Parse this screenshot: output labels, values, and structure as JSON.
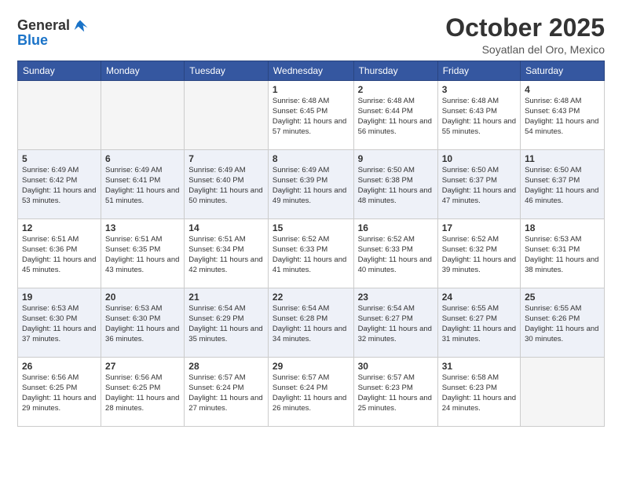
{
  "header": {
    "logo_general": "General",
    "logo_blue": "Blue",
    "month_title": "October 2025",
    "location": "Soyatlan del Oro, Mexico"
  },
  "days_of_week": [
    "Sunday",
    "Monday",
    "Tuesday",
    "Wednesday",
    "Thursday",
    "Friday",
    "Saturday"
  ],
  "weeks": [
    [
      {
        "day": "",
        "info": ""
      },
      {
        "day": "",
        "info": ""
      },
      {
        "day": "",
        "info": ""
      },
      {
        "day": "1",
        "info": "Sunrise: 6:48 AM\nSunset: 6:45 PM\nDaylight: 11 hours\nand 57 minutes."
      },
      {
        "day": "2",
        "info": "Sunrise: 6:48 AM\nSunset: 6:44 PM\nDaylight: 11 hours\nand 56 minutes."
      },
      {
        "day": "3",
        "info": "Sunrise: 6:48 AM\nSunset: 6:43 PM\nDaylight: 11 hours\nand 55 minutes."
      },
      {
        "day": "4",
        "info": "Sunrise: 6:48 AM\nSunset: 6:43 PM\nDaylight: 11 hours\nand 54 minutes."
      }
    ],
    [
      {
        "day": "5",
        "info": "Sunrise: 6:49 AM\nSunset: 6:42 PM\nDaylight: 11 hours\nand 53 minutes."
      },
      {
        "day": "6",
        "info": "Sunrise: 6:49 AM\nSunset: 6:41 PM\nDaylight: 11 hours\nand 51 minutes."
      },
      {
        "day": "7",
        "info": "Sunrise: 6:49 AM\nSunset: 6:40 PM\nDaylight: 11 hours\nand 50 minutes."
      },
      {
        "day": "8",
        "info": "Sunrise: 6:49 AM\nSunset: 6:39 PM\nDaylight: 11 hours\nand 49 minutes."
      },
      {
        "day": "9",
        "info": "Sunrise: 6:50 AM\nSunset: 6:38 PM\nDaylight: 11 hours\nand 48 minutes."
      },
      {
        "day": "10",
        "info": "Sunrise: 6:50 AM\nSunset: 6:37 PM\nDaylight: 11 hours\nand 47 minutes."
      },
      {
        "day": "11",
        "info": "Sunrise: 6:50 AM\nSunset: 6:37 PM\nDaylight: 11 hours\nand 46 minutes."
      }
    ],
    [
      {
        "day": "12",
        "info": "Sunrise: 6:51 AM\nSunset: 6:36 PM\nDaylight: 11 hours\nand 45 minutes."
      },
      {
        "day": "13",
        "info": "Sunrise: 6:51 AM\nSunset: 6:35 PM\nDaylight: 11 hours\nand 43 minutes."
      },
      {
        "day": "14",
        "info": "Sunrise: 6:51 AM\nSunset: 6:34 PM\nDaylight: 11 hours\nand 42 minutes."
      },
      {
        "day": "15",
        "info": "Sunrise: 6:52 AM\nSunset: 6:33 PM\nDaylight: 11 hours\nand 41 minutes."
      },
      {
        "day": "16",
        "info": "Sunrise: 6:52 AM\nSunset: 6:33 PM\nDaylight: 11 hours\nand 40 minutes."
      },
      {
        "day": "17",
        "info": "Sunrise: 6:52 AM\nSunset: 6:32 PM\nDaylight: 11 hours\nand 39 minutes."
      },
      {
        "day": "18",
        "info": "Sunrise: 6:53 AM\nSunset: 6:31 PM\nDaylight: 11 hours\nand 38 minutes."
      }
    ],
    [
      {
        "day": "19",
        "info": "Sunrise: 6:53 AM\nSunset: 6:30 PM\nDaylight: 11 hours\nand 37 minutes."
      },
      {
        "day": "20",
        "info": "Sunrise: 6:53 AM\nSunset: 6:30 PM\nDaylight: 11 hours\nand 36 minutes."
      },
      {
        "day": "21",
        "info": "Sunrise: 6:54 AM\nSunset: 6:29 PM\nDaylight: 11 hours\nand 35 minutes."
      },
      {
        "day": "22",
        "info": "Sunrise: 6:54 AM\nSunset: 6:28 PM\nDaylight: 11 hours\nand 34 minutes."
      },
      {
        "day": "23",
        "info": "Sunrise: 6:54 AM\nSunset: 6:27 PM\nDaylight: 11 hours\nand 32 minutes."
      },
      {
        "day": "24",
        "info": "Sunrise: 6:55 AM\nSunset: 6:27 PM\nDaylight: 11 hours\nand 31 minutes."
      },
      {
        "day": "25",
        "info": "Sunrise: 6:55 AM\nSunset: 6:26 PM\nDaylight: 11 hours\nand 30 minutes."
      }
    ],
    [
      {
        "day": "26",
        "info": "Sunrise: 6:56 AM\nSunset: 6:25 PM\nDaylight: 11 hours\nand 29 minutes."
      },
      {
        "day": "27",
        "info": "Sunrise: 6:56 AM\nSunset: 6:25 PM\nDaylight: 11 hours\nand 28 minutes."
      },
      {
        "day": "28",
        "info": "Sunrise: 6:57 AM\nSunset: 6:24 PM\nDaylight: 11 hours\nand 27 minutes."
      },
      {
        "day": "29",
        "info": "Sunrise: 6:57 AM\nSunset: 6:24 PM\nDaylight: 11 hours\nand 26 minutes."
      },
      {
        "day": "30",
        "info": "Sunrise: 6:57 AM\nSunset: 6:23 PM\nDaylight: 11 hours\nand 25 minutes."
      },
      {
        "day": "31",
        "info": "Sunrise: 6:58 AM\nSunset: 6:23 PM\nDaylight: 11 hours\nand 24 minutes."
      },
      {
        "day": "",
        "info": ""
      }
    ]
  ]
}
